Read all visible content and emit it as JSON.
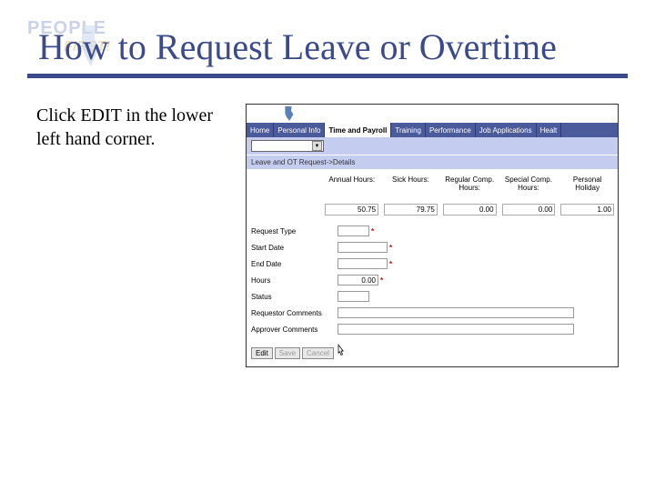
{
  "logo": {
    "line1": "PEOPLE",
    "line2": "FIRST!"
  },
  "title": "How to Request Leave or Overtime",
  "instruction": "Click EDIT in the lower left hand corner.",
  "screenshot": {
    "tabs": [
      {
        "label": "Home",
        "active": false
      },
      {
        "label": "Personal Info",
        "active": false
      },
      {
        "label": "Time and Payroll",
        "active": true
      },
      {
        "label": "Training",
        "active": false
      },
      {
        "label": "Performance",
        "active": false
      },
      {
        "label": "Job Applications",
        "active": false
      },
      {
        "label": "Healt",
        "active": false
      }
    ],
    "breadcrumb": "Leave and OT Request->Details",
    "balances": [
      {
        "label": "Annual Hours:",
        "value": "50.75"
      },
      {
        "label": "Sick Hours:",
        "value": "79.75"
      },
      {
        "label": "Regular Comp. Hours:",
        "value": "0.00"
      },
      {
        "label": "Special Comp. Hours:",
        "value": "0.00"
      },
      {
        "label": "Personal Holiday",
        "value": "1.00"
      }
    ],
    "form": {
      "request_type_label": "Request Type",
      "start_date_label": "Start Date",
      "end_date_label": "End Date",
      "hours_label": "Hours",
      "hours_value": "0.00",
      "status_label": "Status",
      "requestor_comments_label": "Requestor Comments",
      "approver_comments_label": "Approver Comments"
    },
    "buttons": {
      "edit": "Edit",
      "save": "Save",
      "cancel": "Cancel"
    }
  }
}
